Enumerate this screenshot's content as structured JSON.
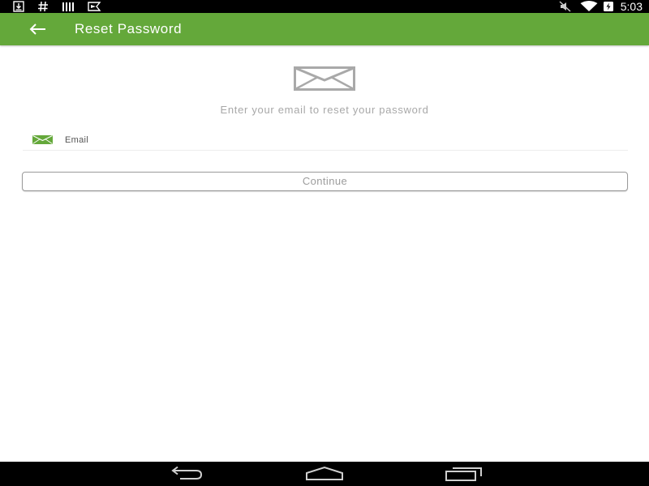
{
  "status_bar": {
    "time": "5:03",
    "left_icons": [
      "download-icon",
      "hash-icon",
      "signal-bars-icon",
      "play-store-icon"
    ],
    "right_icons": [
      "mute-icon",
      "wifi-icon",
      "battery-charging-icon"
    ]
  },
  "app_bar": {
    "title": "Reset Password",
    "back_icon": "arrow-left-icon",
    "color": "#64a83a"
  },
  "content": {
    "hero_icon": "envelope-icon",
    "prompt": "Enter your email to reset your password",
    "email_field": {
      "icon": "envelope-icon",
      "placeholder": "Email",
      "value": ""
    },
    "continue_label": "Continue"
  },
  "nav_bar": {
    "buttons": [
      "back-nav-icon",
      "home-nav-icon",
      "recents-nav-icon"
    ]
  }
}
